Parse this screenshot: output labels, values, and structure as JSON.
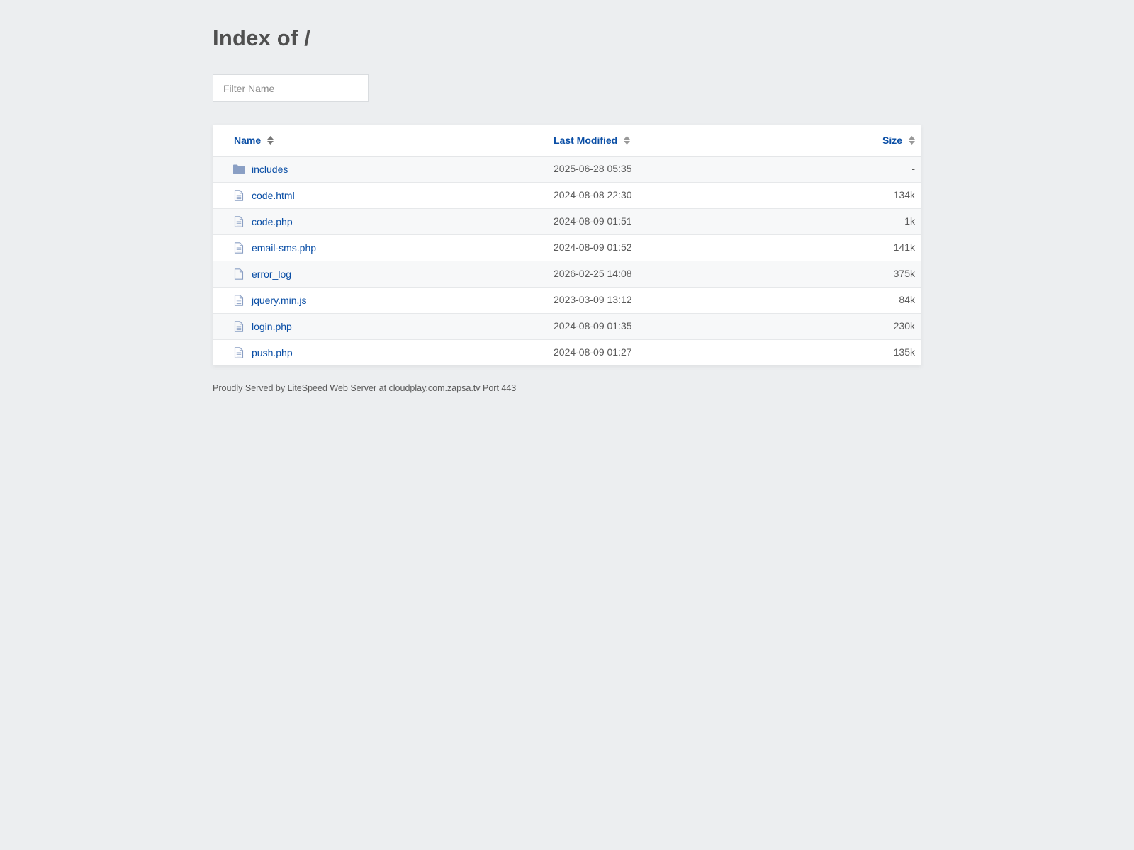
{
  "page": {
    "title": "Index of /"
  },
  "filter": {
    "placeholder": "Filter Name"
  },
  "table": {
    "columns": {
      "name": "Name",
      "last_modified": "Last Modified",
      "size": "Size"
    },
    "rows": [
      {
        "icon": "folder-icon",
        "name": "includes",
        "modified": "2025-06-28 05:35",
        "size": "-"
      },
      {
        "icon": "file-text-icon",
        "name": "code.html",
        "modified": "2024-08-08 22:30",
        "size": "134k"
      },
      {
        "icon": "file-text-icon",
        "name": "code.php",
        "modified": "2024-08-09 01:51",
        "size": "1k"
      },
      {
        "icon": "file-text-icon",
        "name": "email-sms.php",
        "modified": "2024-08-09 01:52",
        "size": "141k"
      },
      {
        "icon": "file-icon",
        "name": "error_log",
        "modified": "2026-02-25 14:08",
        "size": "375k"
      },
      {
        "icon": "file-text-icon",
        "name": "jquery.min.js",
        "modified": "2023-03-09 13:12",
        "size": "84k"
      },
      {
        "icon": "file-text-icon",
        "name": "login.php",
        "modified": "2024-08-09 01:35",
        "size": "230k"
      },
      {
        "icon": "file-text-icon",
        "name": "push.php",
        "modified": "2024-08-09 01:27",
        "size": "135k"
      }
    ]
  },
  "footer": {
    "text": "Proudly Served by LiteSpeed Web Server at cloudplay.com.zapsa.tv Port 443"
  },
  "colors": {
    "background": "#eceef0",
    "link": "#0b4fa6",
    "icon": "#8a9fc4"
  }
}
